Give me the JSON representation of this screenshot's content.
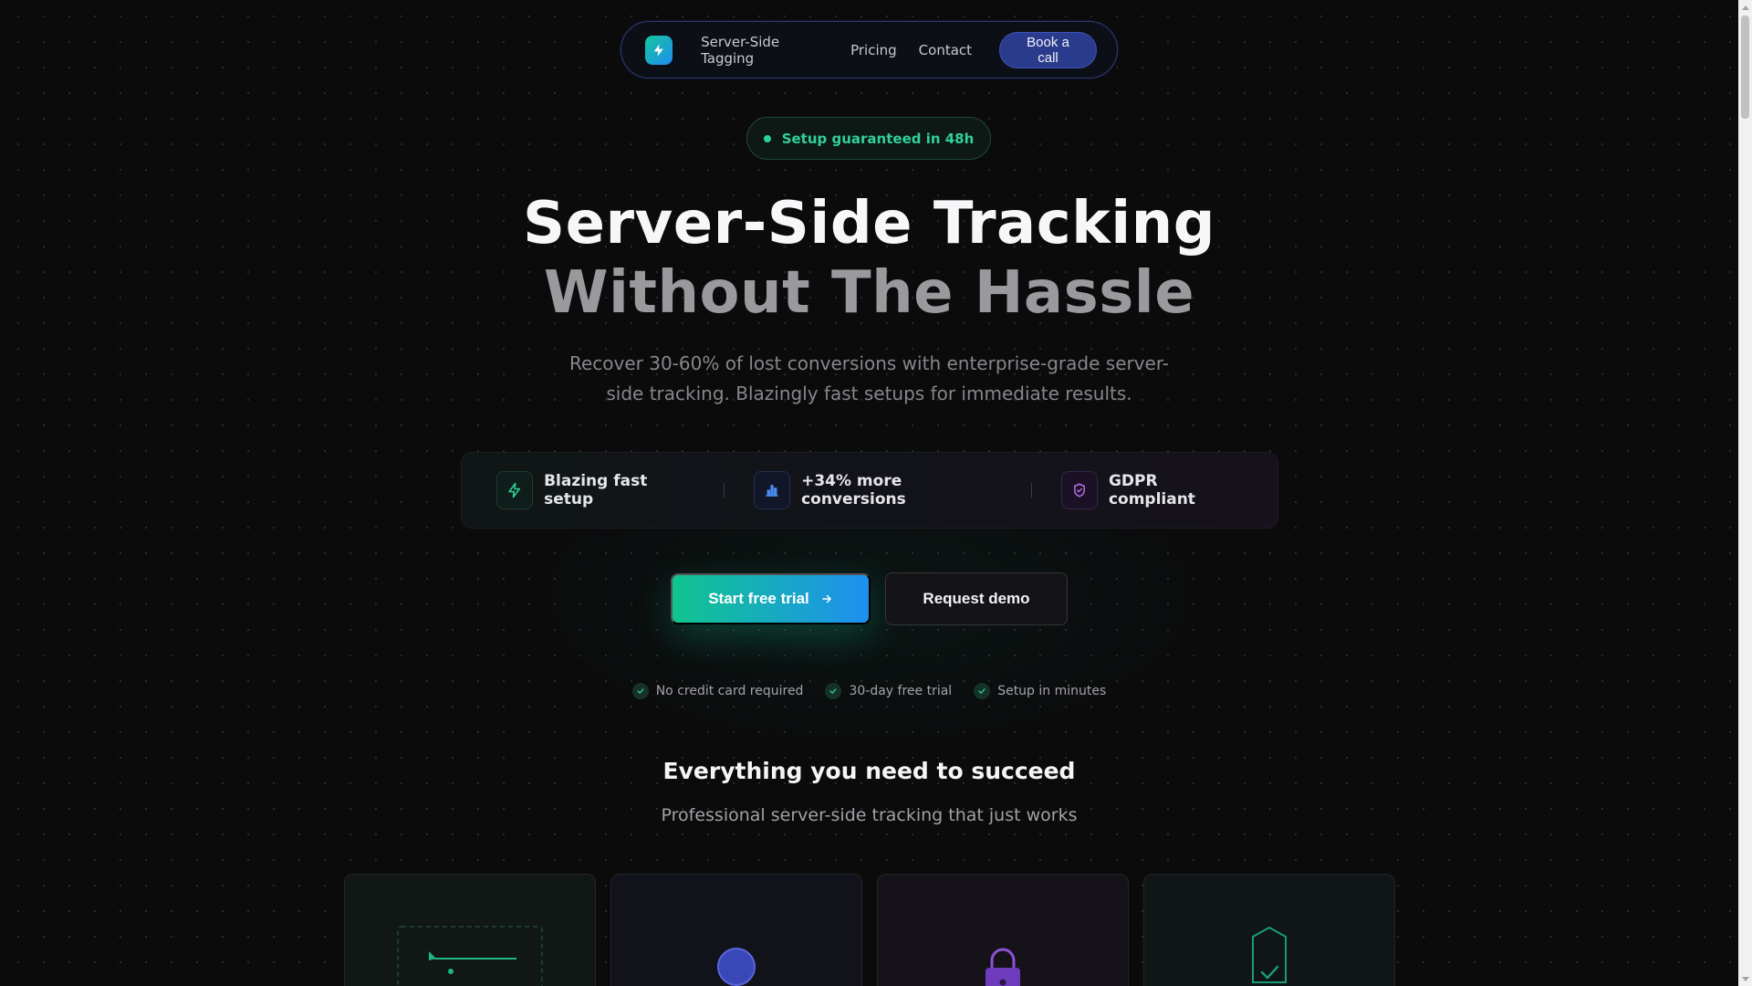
{
  "nav": {
    "links": [
      "Server-Side Tagging",
      "Pricing",
      "Contact"
    ],
    "cta_label": "Book a call"
  },
  "badge": {
    "text": "Setup guaranteed in 48h"
  },
  "hero": {
    "title_line1": "Server-Side Tracking",
    "title_line2": "Without The Hassle",
    "subtitle": "Recover 30-60% of lost conversions with enterprise-grade server-side tracking. Blazingly fast setups for immediate results."
  },
  "features": [
    {
      "label": "Blazing fast setup",
      "icon": "lightning-icon"
    },
    {
      "label": "+34% more conversions",
      "icon": "bar-chart-icon"
    },
    {
      "label": "GDPR compliant",
      "icon": "shield-icon"
    }
  ],
  "cta": {
    "primary_label": "Start free trial",
    "primary_icon": "arrow-right-icon",
    "secondary_label": "Request demo"
  },
  "trust": [
    "No credit card required",
    "30-day free trial",
    "Setup in minutes"
  ],
  "section": {
    "title": "Everything you need to succeed",
    "subtitle": "Professional server-side tracking that just works"
  },
  "cards": [
    {
      "icon": "tracking-chart-icon"
    },
    {
      "icon": "globe-icon"
    },
    {
      "icon": "lock-icon"
    },
    {
      "icon": "shield-check-icon"
    }
  ],
  "colors": {
    "background": "#0b0b0c",
    "accent_green": "#10c58e",
    "accent_blue": "#1e90f0",
    "nav_cta": "#2a3a8c",
    "badge_text": "#2fd19a"
  }
}
